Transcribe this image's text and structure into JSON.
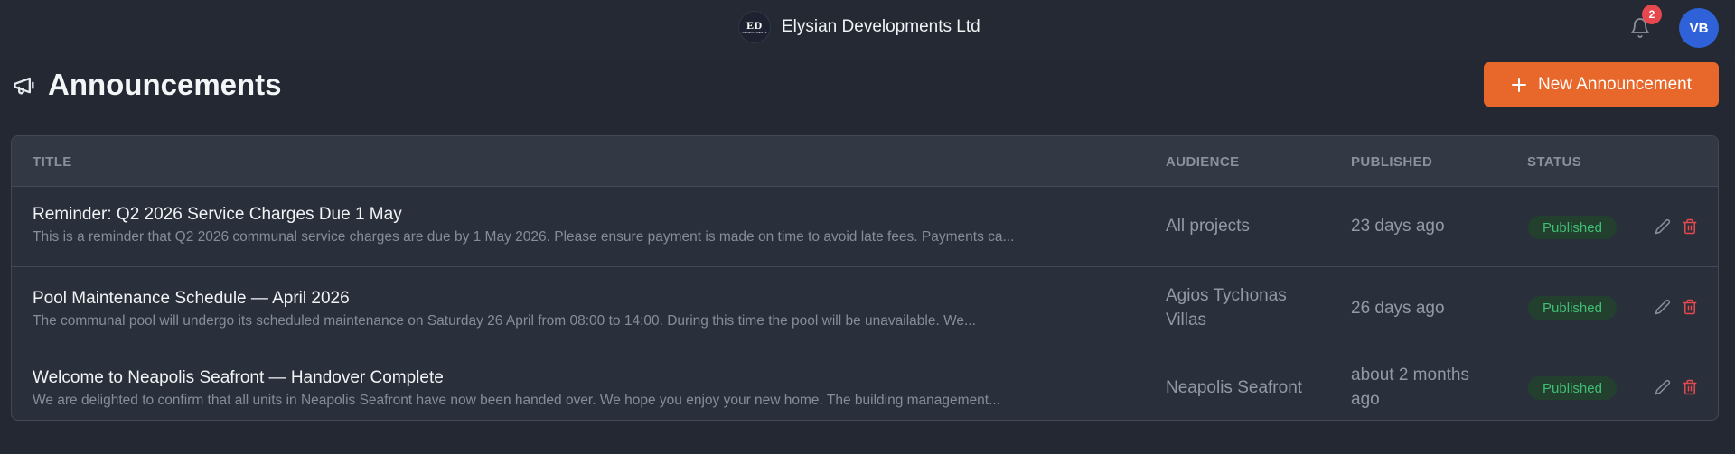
{
  "header": {
    "logo_text": "ED",
    "logo_subtext": "DEVELOPMENTS",
    "company_name": "Elysian Developments Ltd",
    "notification_count": "2",
    "user_initials": "VB"
  },
  "page": {
    "title": "Announcements",
    "new_button_label": "New Announcement"
  },
  "table": {
    "columns": [
      "TITLE",
      "AUDIENCE",
      "PUBLISHED",
      "STATUS"
    ],
    "rows": [
      {
        "title": "Reminder: Q2 2026 Service Charges Due 1 May",
        "body": "This is a reminder that Q2 2026 communal service charges are due by 1 May 2026. Please ensure payment is made on time to avoid late fees. Payments ca...",
        "audience": "All projects",
        "published": "23 days ago",
        "status": "Published"
      },
      {
        "title": "Pool Maintenance Schedule — April 2026",
        "body": "The communal pool will undergo its scheduled maintenance on Saturday 26 April from 08:00 to 14:00. During this time the pool will be unavailable. We...",
        "audience": "Agios Tychonas Villas",
        "published": "26 days ago",
        "status": "Published"
      },
      {
        "title": "Welcome to Neapolis Seafront — Handover Complete",
        "body": "We are delighted to confirm that all units in Neapolis Seafront have now been handed over. We hope you enjoy your new home. The building management...",
        "audience": "Neapolis Seafront",
        "published": "about 2 months ago",
        "status": "Published"
      }
    ]
  },
  "colors": {
    "background": "#232833",
    "accent": "#e8672a",
    "status_published": "#3fbf74",
    "delete": "#e5484d",
    "avatar": "#2f62d8"
  },
  "icons": {
    "page_title": "megaphone-icon",
    "notifications": "bell-icon",
    "edit": "pencil-icon",
    "delete": "trash-icon",
    "add": "plus-icon"
  }
}
